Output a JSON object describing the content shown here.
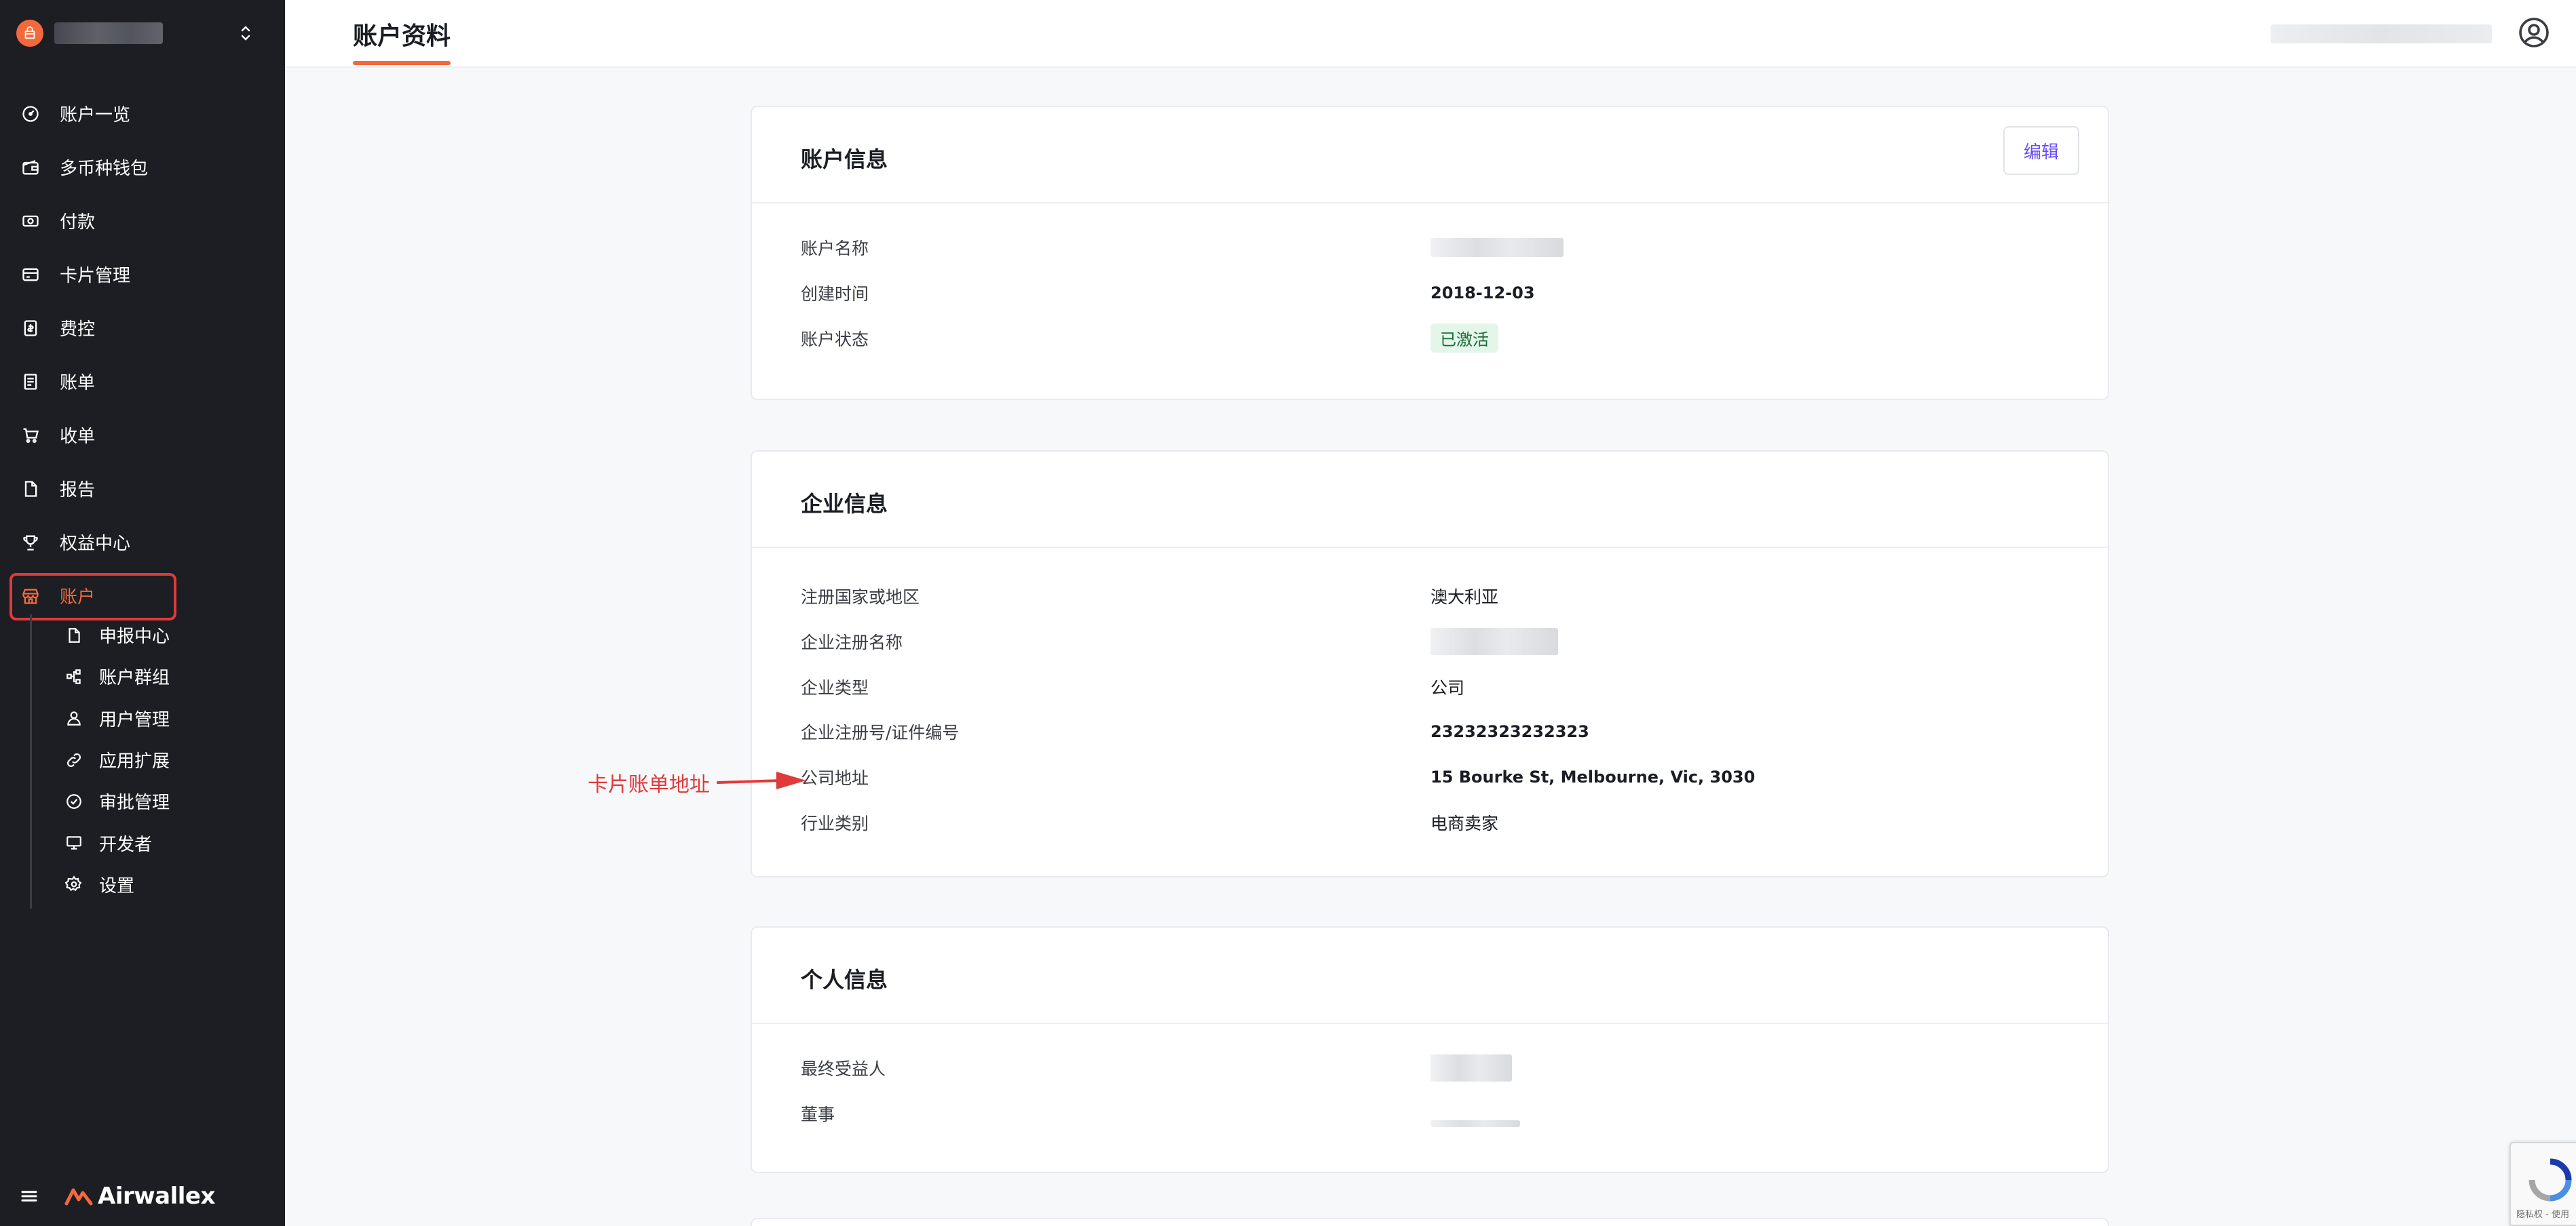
{
  "sidebar": {
    "items": [
      {
        "label": "账户一览",
        "icon": "dashboard-icon"
      },
      {
        "label": "多币种钱包",
        "icon": "wallet-icon"
      },
      {
        "label": "付款",
        "icon": "payment-icon"
      },
      {
        "label": "卡片管理",
        "icon": "card-icon"
      },
      {
        "label": "费控",
        "icon": "expense-icon"
      },
      {
        "label": "账单",
        "icon": "bill-icon"
      },
      {
        "label": "收单",
        "icon": "cart-icon"
      },
      {
        "label": "报告",
        "icon": "report-icon"
      },
      {
        "label": "权益中心",
        "icon": "trophy-icon"
      },
      {
        "label": "账户",
        "icon": "store-icon",
        "active": true
      }
    ],
    "subitems": [
      {
        "label": "申报中心",
        "icon": "document-icon"
      },
      {
        "label": "账户群组",
        "icon": "group-icon"
      },
      {
        "label": "用户管理",
        "icon": "user-icon"
      },
      {
        "label": "应用扩展",
        "icon": "link-icon"
      },
      {
        "label": "审批管理",
        "icon": "check-circle-icon"
      },
      {
        "label": "开发者",
        "icon": "monitor-icon"
      },
      {
        "label": "设置",
        "icon": "gear-icon"
      }
    ],
    "brand": "Airwallex"
  },
  "header": {
    "title": "账户资料"
  },
  "account_info": {
    "title": "账户信息",
    "edit_label": "编辑",
    "rows": [
      {
        "label": "账户名称",
        "value": null
      },
      {
        "label": "创建时间",
        "value": "2018-12-03"
      },
      {
        "label": "账户状态",
        "value": "已激活"
      }
    ]
  },
  "business_info": {
    "title": "企业信息",
    "rows": [
      {
        "label": "注册国家或地区",
        "value": "澳大利亚"
      },
      {
        "label": "企业注册名称",
        "value": null
      },
      {
        "label": "企业类型",
        "value": "公司"
      },
      {
        "label": "企业注册号/证件编号",
        "value": "23232323232323"
      },
      {
        "label": "公司地址",
        "value": "15 Bourke St, Melbourne, Vic, 3030"
      },
      {
        "label": "行业类别",
        "value": "电商卖家"
      }
    ]
  },
  "personal_info": {
    "title": "个人信息",
    "rows": [
      {
        "label": "最终受益人",
        "value": null
      },
      {
        "label": "董事",
        "value": null
      }
    ]
  },
  "annotation": {
    "text": "卡片账单地址",
    "color": "#e03a3a"
  },
  "recaptcha": {
    "text": "隐私权 - 使用"
  },
  "colors": {
    "accent": "#f4693c",
    "sidebar_bg": "#1c1e23",
    "link": "#6c4cf4",
    "status_bg": "#e4f6ea"
  }
}
